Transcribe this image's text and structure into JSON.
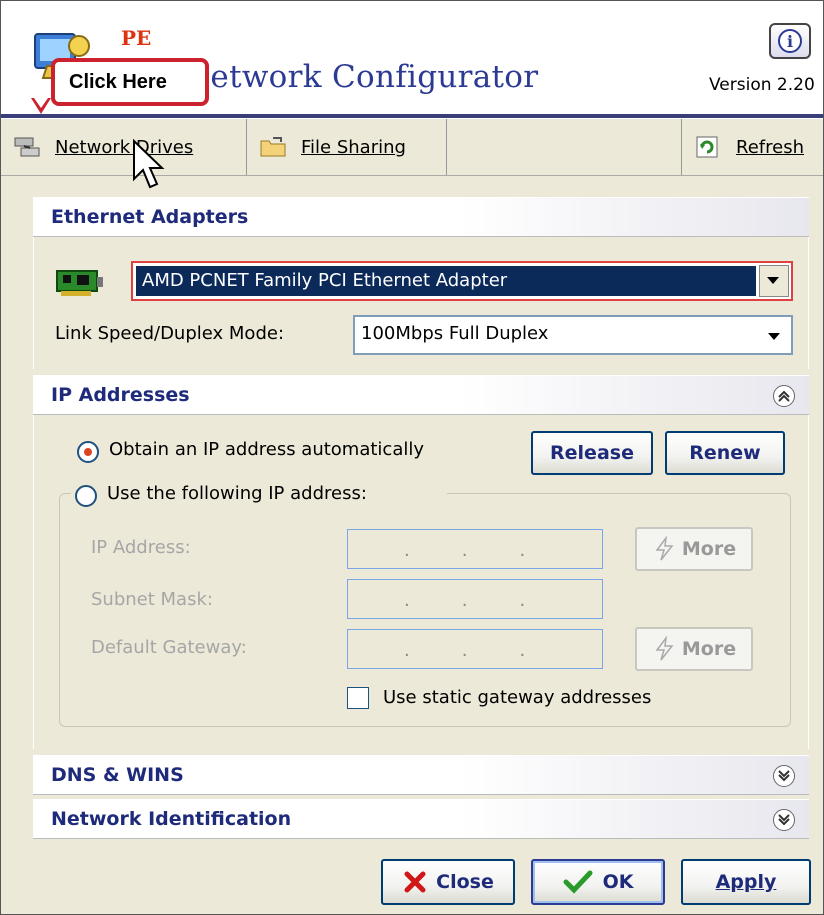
{
  "header": {
    "brand_short": "PE",
    "app_title": "Network Configurator",
    "version": "Version 2.20",
    "info_icon": "info-icon"
  },
  "callout": {
    "text": "Click Here"
  },
  "toolbar": {
    "network_drives": "Network Drives",
    "file_sharing": "File Sharing",
    "refresh": "Refresh"
  },
  "ethernet": {
    "section_title": "Ethernet Adapters",
    "adapter_selected": "AMD PCNET Family PCI Ethernet Adapter",
    "link_label": "Link Speed/Duplex Mode:",
    "link_value": "100Mbps Full Duplex"
  },
  "ip": {
    "section_title": "IP Addresses",
    "auto_label": "Obtain an IP address automatically",
    "manual_label": "Use the following IP address:",
    "release": "Release",
    "renew": "Renew",
    "ip_address_label": "IP Address:",
    "subnet_label": "Subnet Mask:",
    "gateway_label": "Default Gateway:",
    "more": "More",
    "static_gateway_label": "Use static gateway addresses",
    "auto_selected": true
  },
  "dns": {
    "section_title": "DNS & WINS"
  },
  "netid": {
    "section_title": "Network Identification"
  },
  "footer": {
    "close": "Close",
    "ok": "OK",
    "apply": "Apply"
  },
  "colors": {
    "accent_title": "#2c3a94",
    "section_title": "#1e2a7a",
    "callout_border": "#cc2230",
    "selection": "#0b2a5a"
  }
}
